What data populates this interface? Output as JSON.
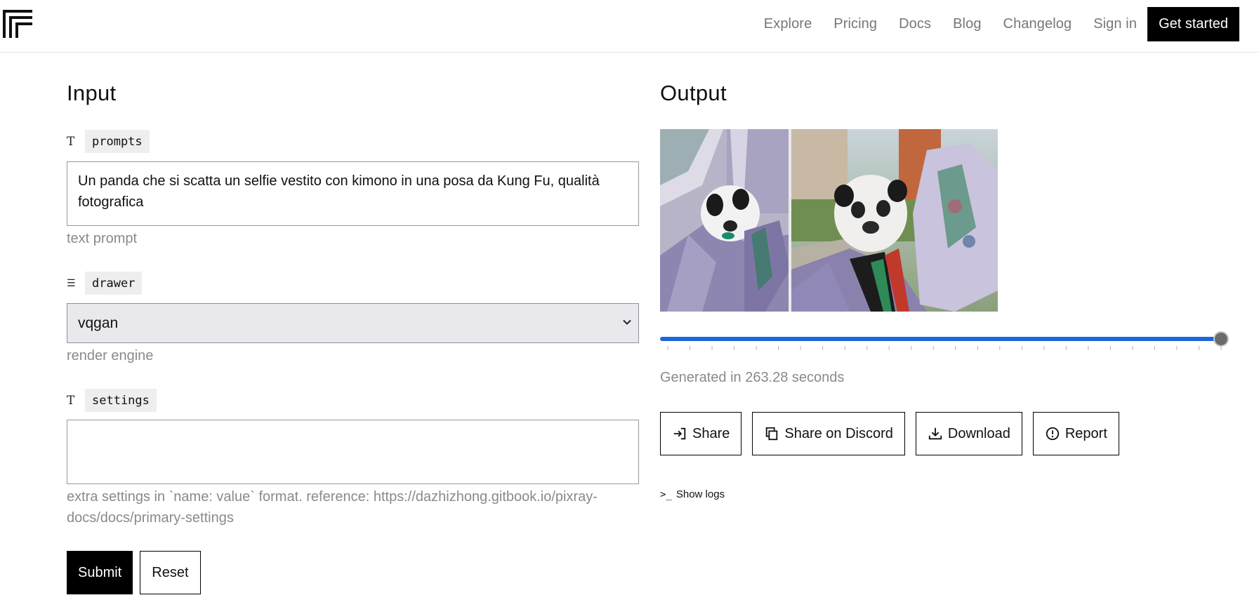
{
  "nav": {
    "logo_icon": "replicate-logo-icon",
    "links": [
      "Explore",
      "Pricing",
      "Docs",
      "Blog",
      "Changelog",
      "Sign in"
    ],
    "cta": "Get started"
  },
  "input": {
    "title": "Input",
    "prompts": {
      "icon": "text-type-icon",
      "key": "prompts",
      "value": "Un panda che si scatta un selfie vestito con kimono in una posa da Kung Fu, qualità fotografica",
      "hint": "text prompt"
    },
    "drawer": {
      "icon": "list-icon",
      "key": "drawer",
      "selected": "vqgan",
      "hint": "render engine"
    },
    "settings": {
      "icon": "text-type-icon",
      "key": "settings",
      "value": "",
      "hint": "extra settings in `name: value` format. reference: https://dazhizhong.gitbook.io/pixray-docs/docs/primary-settings"
    },
    "submit": "Submit",
    "reset": "Reset"
  },
  "output": {
    "title": "Output",
    "image_alt": "panda selfie in kimono",
    "slider_position": 1.0,
    "slider_ticks": 26,
    "generated_text": "Generated in 263.28 seconds",
    "actions": [
      {
        "label": "Share",
        "icon": "share-icon"
      },
      {
        "label": "Share on Discord",
        "icon": "copy-icon"
      },
      {
        "label": "Download",
        "icon": "download-icon"
      },
      {
        "label": "Report",
        "icon": "report-icon"
      }
    ],
    "show_logs": "Show logs"
  },
  "colors": {
    "accent": "#1b66d8",
    "cta_bg": "#000000",
    "hint": "#8a8a8a"
  }
}
